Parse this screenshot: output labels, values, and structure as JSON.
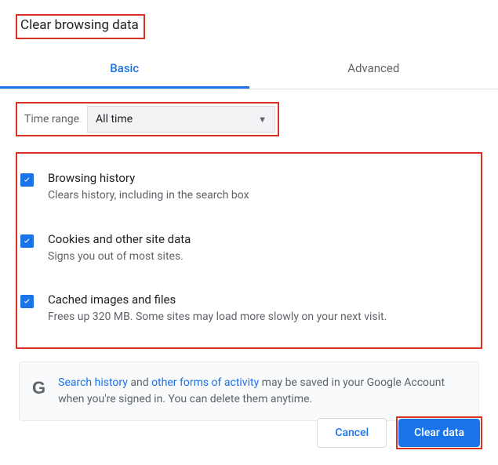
{
  "title": "Clear browsing data",
  "tabs": {
    "basic": "Basic",
    "advanced": "Advanced"
  },
  "timerange": {
    "label": "Time range",
    "value": "All time"
  },
  "options": [
    {
      "title": "Browsing history",
      "desc": "Clears history, including in the search box"
    },
    {
      "title": "Cookies and other site data",
      "desc": "Signs you out of most sites."
    },
    {
      "title": "Cached images and files",
      "desc": "Frees up 320 MB. Some sites may load more slowly on your next visit."
    }
  ],
  "info": {
    "link1": "Search history",
    "mid1": " and ",
    "link2": "other forms of activity",
    "rest": " may be saved in your Google Account when you're signed in. You can delete them anytime."
  },
  "buttons": {
    "cancel": "Cancel",
    "clear": "Clear data"
  }
}
